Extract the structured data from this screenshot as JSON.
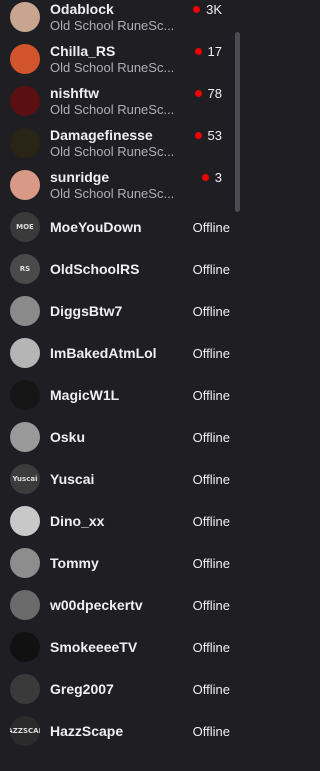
{
  "channels": [
    {
      "name": "Odablock",
      "game": "Old School RuneSc...",
      "viewers": "3K",
      "live": true,
      "avatar_color": "#c7a58f"
    },
    {
      "name": "Chilla_RS",
      "game": "Old School RuneSc...",
      "viewers": "17",
      "live": true,
      "avatar_color": "#d2542c"
    },
    {
      "name": "nishftw",
      "game": "Old School RuneSc...",
      "viewers": "78",
      "live": true,
      "avatar_color": "#5a1010"
    },
    {
      "name": "Damagefinesse",
      "game": "Old School RuneSc...",
      "viewers": "53",
      "live": true,
      "avatar_color": "#2a2416"
    },
    {
      "name": "sunridge",
      "game": "Old School RuneSc...",
      "viewers": "3",
      "live": true,
      "avatar_color": "#d89a86"
    },
    {
      "name": "MoeYouDown",
      "status": "Offline",
      "live": false,
      "avatar_color": "#3a3a3a",
      "avatar_text": "MOE"
    },
    {
      "name": "OldSchoolRS",
      "status": "Offline",
      "live": false,
      "avatar_color": "#4a4a4a",
      "avatar_text": "RS"
    },
    {
      "name": "DiggsBtw7",
      "status": "Offline",
      "live": false,
      "avatar_color": "#8a8a8a"
    },
    {
      "name": "ImBakedAtmLol",
      "status": "Offline",
      "live": false,
      "avatar_color": "#b5b5b5"
    },
    {
      "name": "MagicW1L",
      "status": "Offline",
      "live": false,
      "avatar_color": "#151515"
    },
    {
      "name": "Osku",
      "status": "Offline",
      "live": false,
      "avatar_color": "#999999"
    },
    {
      "name": "Yuscai",
      "status": "Offline",
      "live": false,
      "avatar_color": "#3c3c3c",
      "avatar_text": "Yuscai"
    },
    {
      "name": "Dino_xx",
      "status": "Offline",
      "live": false,
      "avatar_color": "#c8c8c8"
    },
    {
      "name": "Tommy",
      "status": "Offline",
      "live": false,
      "avatar_color": "#8d8d8d"
    },
    {
      "name": "w00dpeckertv",
      "status": "Offline",
      "live": false,
      "avatar_color": "#6b6b6b"
    },
    {
      "name": "SmokeeeeTV",
      "status": "Offline",
      "live": false,
      "avatar_color": "#111111"
    },
    {
      "name": "Greg2007",
      "status": "Offline",
      "live": false,
      "avatar_color": "#3a3a3a"
    },
    {
      "name": "HazzScape",
      "status": "Offline",
      "live": false,
      "avatar_color": "#2b2b2b",
      "avatar_text": "HAZZSCAPE"
    }
  ],
  "colors": {
    "background": "#1f1f23",
    "live_dot": "#eb0400",
    "name_text": "#efeff1",
    "game_text": "#adadb8"
  }
}
